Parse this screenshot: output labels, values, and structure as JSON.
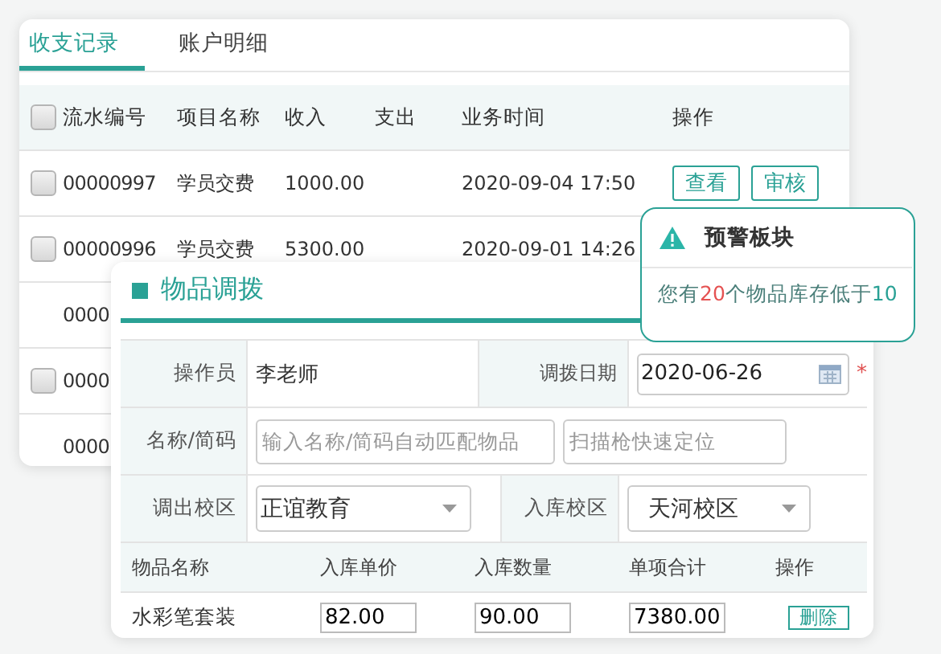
{
  "records_panel": {
    "tabs": [
      {
        "label": "收支记录",
        "selected": true
      },
      {
        "label": "账户明细",
        "selected": false
      }
    ],
    "select_all_checked": false,
    "columns": [
      "流水编号",
      "项目名称",
      "收入",
      "支出",
      "业务时间",
      "操作"
    ],
    "rows": [
      {
        "checkbox": true,
        "checked": false,
        "id": "00000997",
        "item": "学员交费",
        "income": "1000.00",
        "time": "2020-09-04 17:50",
        "actions": [
          "查看",
          "审核"
        ]
      },
      {
        "checkbox": true,
        "checked": false,
        "id": "00000996",
        "item": "学员交费",
        "income": "5300.00",
        "time": "2020-09-01 14:26",
        "actions": []
      },
      {
        "checkbox": false,
        "id": "0000",
        "item": "",
        "income": "",
        "time": "",
        "actions": []
      },
      {
        "checkbox": true,
        "checked": false,
        "id": "0000",
        "item": "",
        "income": "",
        "time": "",
        "actions": []
      },
      {
        "checkbox": false,
        "id": "0000",
        "item": "",
        "income": "",
        "time": "",
        "actions": []
      }
    ]
  },
  "transfer_dialog": {
    "title": "物品调拨",
    "operator": {
      "label": "操作员",
      "value": "李老师"
    },
    "date": {
      "label": "调拨日期",
      "value": "2020-06-26",
      "required_mark": "*"
    },
    "search": {
      "label": "名称/简码",
      "placeholder": "输入名称/简码自动匹配物品",
      "scan_placeholder": "扫描枪快速定位"
    },
    "from_campus": {
      "label": "调出校区",
      "value": "正谊教育"
    },
    "to_campus": {
      "label": "入库校区",
      "value": "天河校区"
    },
    "columns": [
      "物品名称",
      "入库单价",
      "入库数量",
      "单项合计",
      "操作"
    ],
    "rows": [
      {
        "name": "水彩笔套装",
        "price": "82.00",
        "quantity": "90.00",
        "total": "7380.00",
        "action": "删除"
      }
    ]
  },
  "alert_popup": {
    "title": "预警板块",
    "prefix": "您有",
    "count": "20",
    "middle": "个物品库存低于",
    "threshold": "10"
  }
}
